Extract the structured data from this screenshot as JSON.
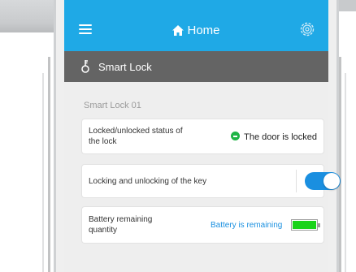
{
  "header": {
    "title": "Home",
    "menu_icon": "hamburger-menu-icon",
    "home_icon": "home-icon",
    "settings_icon": "gear-icon",
    "color": "#1fa9e6"
  },
  "subheader": {
    "title": "Smart Lock",
    "icon": "key-icon",
    "color": "#646464"
  },
  "device": {
    "name": "Smart Lock 01"
  },
  "cards": {
    "status": {
      "label": "Locked/unlocked status of the lock",
      "value": "The door is locked",
      "indicator_color": "#1fb446"
    },
    "key": {
      "label": "Locking and unlocking of the key",
      "toggle_on": true,
      "toggle_color": "#1a8fe0"
    },
    "battery": {
      "label": "Battery remaining quantity",
      "value": "Battery is remaining",
      "level": 1.0,
      "fill_color": "#19d319"
    }
  }
}
